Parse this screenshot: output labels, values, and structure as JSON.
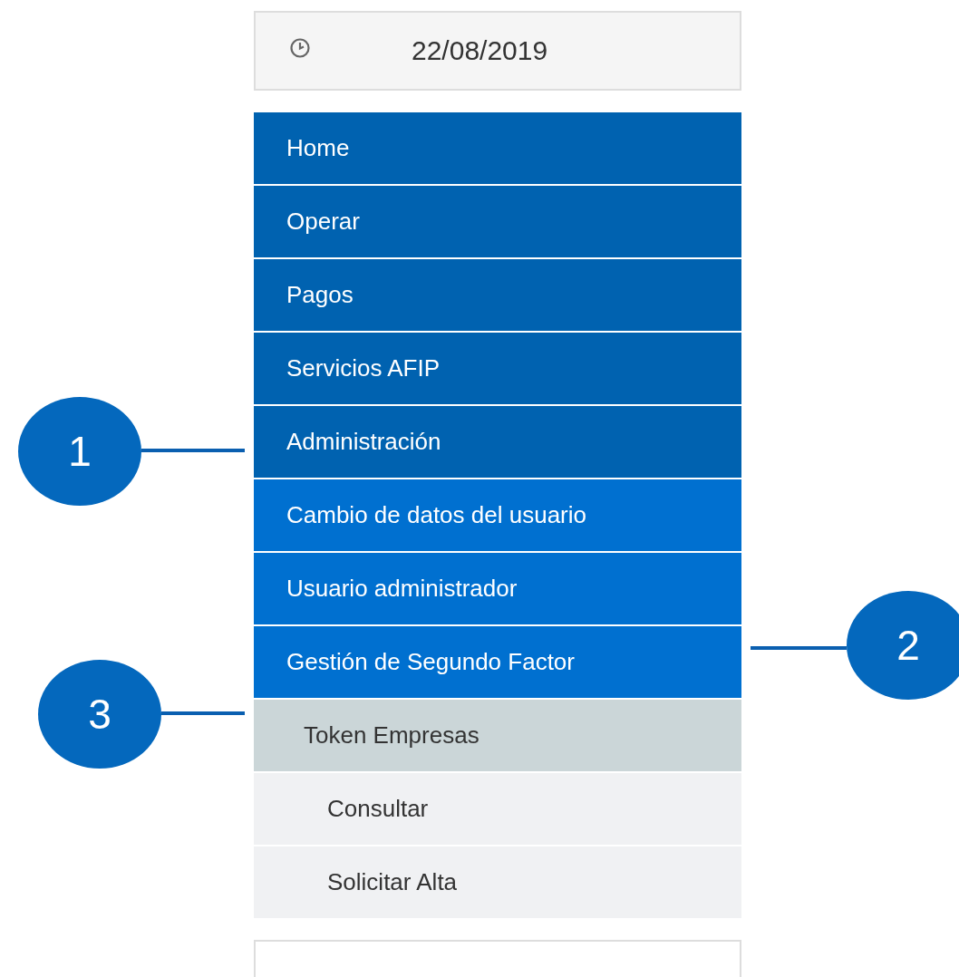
{
  "date_box": {
    "date": "22/08/2019"
  },
  "menu": [
    {
      "label": "Home",
      "kind": "main"
    },
    {
      "label": "Operar",
      "kind": "main"
    },
    {
      "label": "Pagos",
      "kind": "main"
    },
    {
      "label": "Servicios AFIP",
      "kind": "main"
    },
    {
      "label": "Administración",
      "kind": "main"
    },
    {
      "label": "Cambio de datos del usuario",
      "kind": "sub"
    },
    {
      "label": "Usuario administrador",
      "kind": "sub"
    },
    {
      "label": "Gestión de Segundo Factor",
      "kind": "sub"
    },
    {
      "label": "Token Empresas",
      "kind": "group"
    },
    {
      "label": "Consultar",
      "kind": "leaf"
    },
    {
      "label": "Solicitar Alta",
      "kind": "leaf"
    }
  ],
  "callouts": [
    {
      "number": "1"
    },
    {
      "number": "2"
    },
    {
      "number": "3"
    }
  ]
}
